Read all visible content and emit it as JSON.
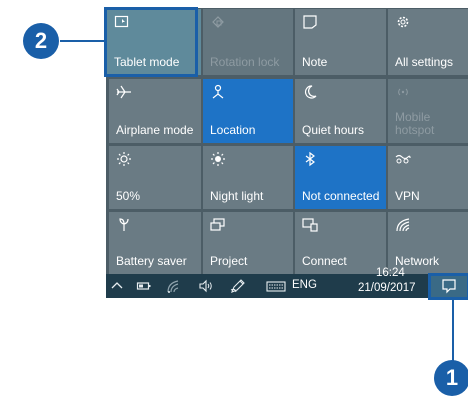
{
  "tiles": [
    {
      "id": "tablet-mode",
      "label": "Tablet mode",
      "state": "on",
      "icon": "tablet-mode-icon"
    },
    {
      "id": "rotation-lock",
      "label": "Rotation lock",
      "state": "disabled",
      "icon": "rotation-lock-icon"
    },
    {
      "id": "note",
      "label": "Note",
      "state": "off",
      "icon": "note-icon"
    },
    {
      "id": "all-settings",
      "label": "All settings",
      "state": "off",
      "icon": "gear-icon"
    },
    {
      "id": "airplane-mode",
      "label": "Airplane mode",
      "state": "off",
      "icon": "airplane-icon"
    },
    {
      "id": "location",
      "label": "Location",
      "state": "on",
      "icon": "location-icon"
    },
    {
      "id": "quiet-hours",
      "label": "Quiet hours",
      "state": "off",
      "icon": "moon-icon"
    },
    {
      "id": "mobile-hotspot",
      "label_lines": [
        "Mobile",
        "hotspot"
      ],
      "state": "disabled",
      "icon": "hotspot-icon"
    },
    {
      "id": "brightness",
      "label": "50%",
      "state": "off",
      "icon": "brightness-icon"
    },
    {
      "id": "night-light",
      "label": "Night light",
      "state": "off",
      "icon": "night-light-icon"
    },
    {
      "id": "bluetooth",
      "label": "Not connected",
      "state": "on",
      "icon": "bluetooth-icon"
    },
    {
      "id": "vpn",
      "label": "VPN",
      "state": "off",
      "icon": "vpn-icon"
    },
    {
      "id": "battery-saver",
      "label": "Battery saver",
      "state": "off",
      "icon": "battery-saver-icon"
    },
    {
      "id": "project",
      "label": "Project",
      "state": "off",
      "icon": "project-icon"
    },
    {
      "id": "connect",
      "label": "Connect",
      "state": "off",
      "icon": "connect-icon"
    },
    {
      "id": "network",
      "label": "Network",
      "state": "off",
      "icon": "network-icon"
    }
  ],
  "taskbar": {
    "language": "ENG",
    "time": "16:24",
    "date": "21/09/2017"
  },
  "callouts": {
    "first": "1",
    "second": "2"
  },
  "colors": {
    "tile_on": "#1e73c6",
    "tile_off": "#6a7b84",
    "tile_disabled": "#64767f",
    "panel": "#4c5d66",
    "taskbar": "#1f3c4b",
    "accent_frame": "#1a5fa8"
  }
}
